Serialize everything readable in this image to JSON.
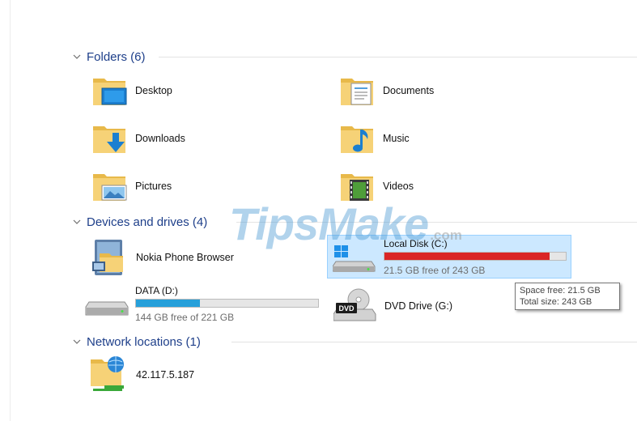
{
  "groups": {
    "folders": {
      "label": "Folders (6)"
    },
    "devices": {
      "label": "Devices and drives (4)"
    },
    "network": {
      "label": "Network locations (1)"
    }
  },
  "folders": [
    {
      "name": "Desktop",
      "icon": "desktop-folder-icon"
    },
    {
      "name": "Documents",
      "icon": "documents-folder-icon"
    },
    {
      "name": "Downloads",
      "icon": "downloads-folder-icon"
    },
    {
      "name": "Music",
      "icon": "music-folder-icon"
    },
    {
      "name": "Pictures",
      "icon": "pictures-folder-icon"
    },
    {
      "name": "Videos",
      "icon": "videos-folder-icon"
    }
  ],
  "devices": {
    "phone": {
      "name": "Nokia Phone Browser",
      "icon": "phone-browser-icon"
    },
    "local_c": {
      "name": "Local Disk (C:)",
      "free_text": "21.5 GB free of 243 GB",
      "used_fraction": 0.91,
      "bar_color": "#da2626",
      "icon": "windows-drive-icon",
      "selected": true
    },
    "data_d": {
      "name": "DATA (D:)",
      "free_text": "144 GB free of 221 GB",
      "used_fraction": 0.35,
      "bar_color": "#26a0da",
      "icon": "hard-drive-icon"
    },
    "dvd_g": {
      "name": "DVD Drive (G:)",
      "icon": "dvd-drive-icon",
      "icon_text": "DVD"
    }
  },
  "tooltip": {
    "line1": "Space free: 21.5 GB",
    "line2": "Total size: 243 GB"
  },
  "network": [
    {
      "name": "42.117.5.187",
      "icon": "network-location-icon"
    }
  ],
  "watermark": {
    "text": "TipsMake",
    "suffix": ".com"
  },
  "colors": {
    "group_header": "#1e3f8a",
    "selection_bg": "#cce8ff",
    "selection_border": "#99d1ff",
    "drive_bar_normal": "#26a0da",
    "drive_bar_full": "#da2626"
  }
}
